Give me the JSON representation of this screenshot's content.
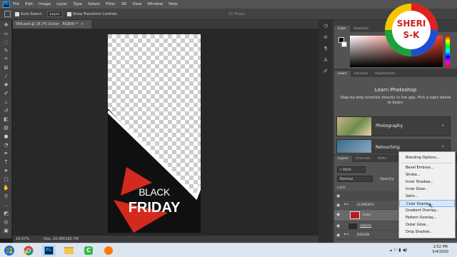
{
  "menubar": {
    "app_icon": "Ps",
    "items": [
      "File",
      "Edit",
      "Image",
      "Layer",
      "Type",
      "Select",
      "Filter",
      "3D",
      "View",
      "Window",
      "Help"
    ]
  },
  "options": {
    "auto_select_label": "Auto-Select:",
    "auto_select_value": "Layer",
    "show_transform_label": "Show Transform Controls",
    "mode_3d_label": "3D Mode:"
  },
  "document": {
    "tab_title": "564.psd @ 16.7% (Color , RGB/8) *",
    "zoom": "16.67%",
    "doc_info": "Doc: 20.0M/182.7M"
  },
  "poster": {
    "line1": "BLACK",
    "line2": "FRIDAY"
  },
  "color_panel": {
    "tabs": [
      "Color",
      "Swatches"
    ]
  },
  "learn_panel": {
    "tabs": [
      "Learn",
      "Libraries",
      "Adjustments"
    ],
    "title": "Learn Photoshop",
    "description": "Step-by-step tutorials directly in the app. Pick a topic below to begin.",
    "cards": [
      "Photography",
      "Retouching"
    ]
  },
  "layers_panel": {
    "tabs": [
      "Layers",
      "Channels",
      "Paths"
    ],
    "kind_label": "Kind",
    "blend_mode": "Normal",
    "opacity_label": "Opacity:",
    "lock_label": "Lock:",
    "layers": [
      "ELEMENTS",
      "Color",
      "objects",
      "DESIGN"
    ]
  },
  "context_menu": {
    "items": [
      "Blending Options...",
      "Bevel  Emboss...",
      "Stroke...",
      "Inner Shadow...",
      "Inner Glow...",
      "Satin...",
      "Color Overlay...",
      "Gradient Overlay...",
      "Pattern Overlay...",
      "Outer Glow...",
      "Drop Shadow..."
    ],
    "highlighted_index": 6
  },
  "taskbar": {
    "time": "2:52 PM",
    "date": "5/4/2020"
  },
  "watermark": {
    "line1": "SHERI",
    "line2": "S-K"
  },
  "colors": {
    "accent_red": "#d42a1e",
    "ui_dark": "#535353",
    "ps_blue": "#31a8ff"
  }
}
